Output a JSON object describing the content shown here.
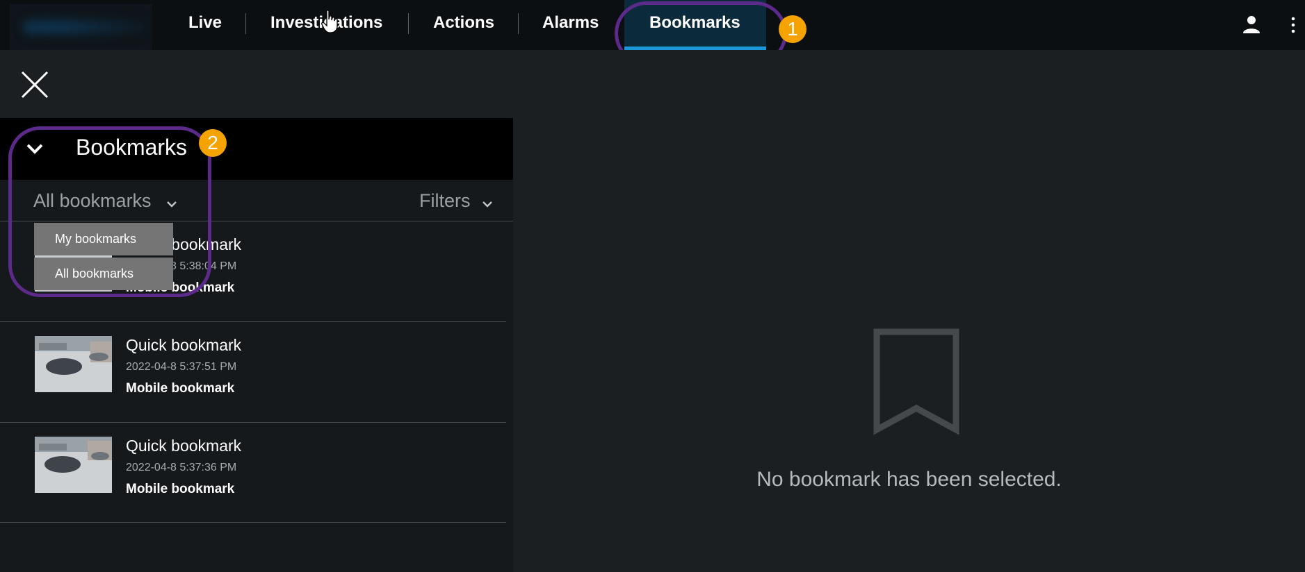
{
  "nav": {
    "items": [
      "Live",
      "Investigations",
      "Actions",
      "Alarms",
      "Bookmarks"
    ],
    "active": "Bookmarks"
  },
  "annotations": [
    "1",
    "2"
  ],
  "panel": {
    "title": "Bookmarks",
    "scope_selected": "All bookmarks",
    "filters_label": "Filters",
    "scope_options": [
      "My bookmarks",
      "All bookmarks"
    ]
  },
  "bookmarks": [
    {
      "title": "Quick bookmark",
      "date": "2022-04-8 5:38:04 PM",
      "subtitle": "Mobile bookmark"
    },
    {
      "title": "Quick bookmark",
      "date": "2022-04-8 5:37:51 PM",
      "subtitle": "Mobile bookmark"
    },
    {
      "title": "Quick bookmark",
      "date": "2022-04-8 5:37:36 PM",
      "subtitle": "Mobile bookmark"
    }
  ],
  "detail": {
    "empty_message": "No bookmark has been selected."
  },
  "colors": {
    "accent": "#1997d6",
    "annotation_outline": "#5c2a8a",
    "annotation_badge": "#f5a300"
  },
  "icons": [
    "close-icon",
    "chevron-down-icon",
    "user-icon",
    "more-vertical-icon",
    "bookmark-icon"
  ]
}
